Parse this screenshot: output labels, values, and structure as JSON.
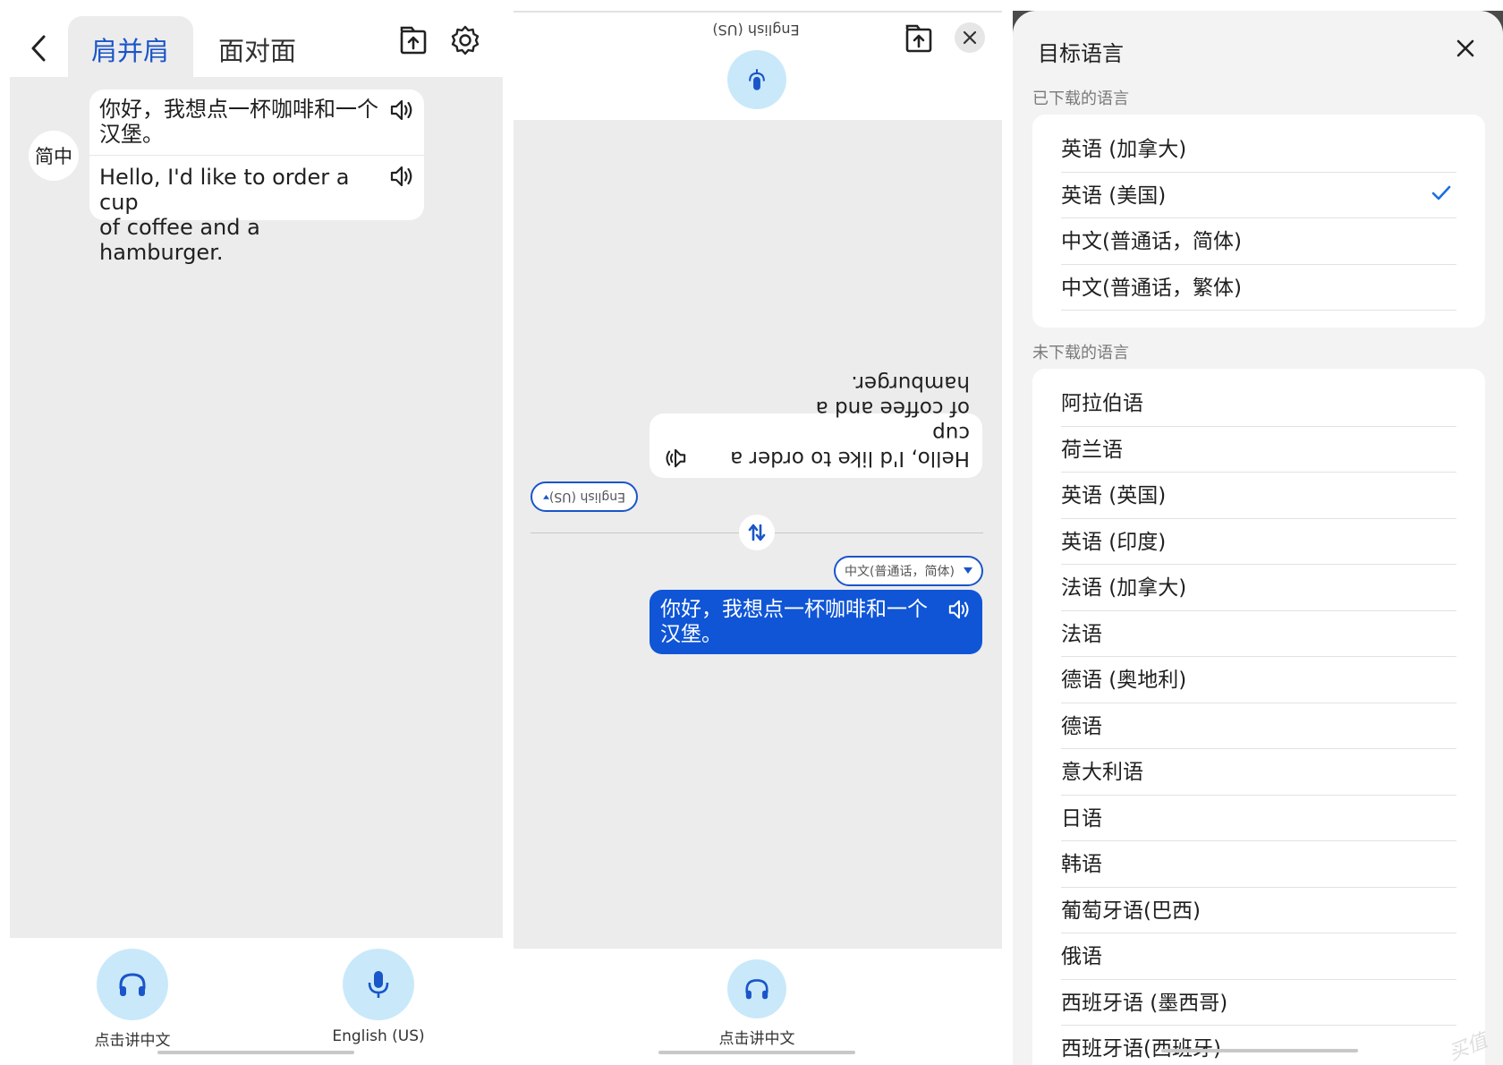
{
  "panel1": {
    "tabs": [
      {
        "label": "肩并肩",
        "active": true
      },
      {
        "label": "面对面",
        "active": false
      }
    ],
    "avatar_label": "简中",
    "message": {
      "source": "你好，我想点一杯咖啡和一个\n汉堡。",
      "translation": "Hello, I'd like to order a cup\nof coffee and a hamburger."
    },
    "buttons": [
      {
        "caption": "点击讲中文",
        "icon": "headphones-icon"
      },
      {
        "caption": "English (US)",
        "icon": "microphone-icon"
      }
    ]
  },
  "panel2": {
    "top_language": "English (US)",
    "flipped_message": "Hello, I'd like to order a cup\nof coffee and a hamburger.",
    "flipped_language_pill": "English (US)",
    "my_language_pill": "中文(普通话，简体)",
    "my_message": "你好，我想点一杯咖啡和一个\n汉堡。",
    "button_caption": "点击讲中文",
    "button_icon": "headphones-icon"
  },
  "panel3": {
    "title": "目标语言",
    "downloaded_label": "已下载的语言",
    "downloaded": [
      {
        "name": "英语 (加拿大)",
        "selected": false
      },
      {
        "name": "英语 (美国)",
        "selected": true
      },
      {
        "name": "中文(普通话，简体)",
        "selected": false
      },
      {
        "name": "中文(普通话，繁体)",
        "selected": false
      }
    ],
    "not_downloaded_label": "未下载的语言",
    "not_downloaded": [
      "阿拉伯语",
      "荷兰语",
      "英语 (英国)",
      "英语 (印度)",
      "法语 (加拿大)",
      "法语",
      "德语 (奥地利)",
      "德语",
      "意大利语",
      "日语",
      "韩语",
      "葡萄牙语(巴西)",
      "俄语",
      "西班牙语 (墨西哥)",
      "西班牙语(西班牙)"
    ],
    "watermark": "买值"
  },
  "colors": {
    "accent_blue": "#1a55c9",
    "bubble_blue": "#0f55d6",
    "light_blue_button": "#c9e9fa",
    "panel_gray": "#ececec",
    "check_blue": "#1a6fe0"
  }
}
